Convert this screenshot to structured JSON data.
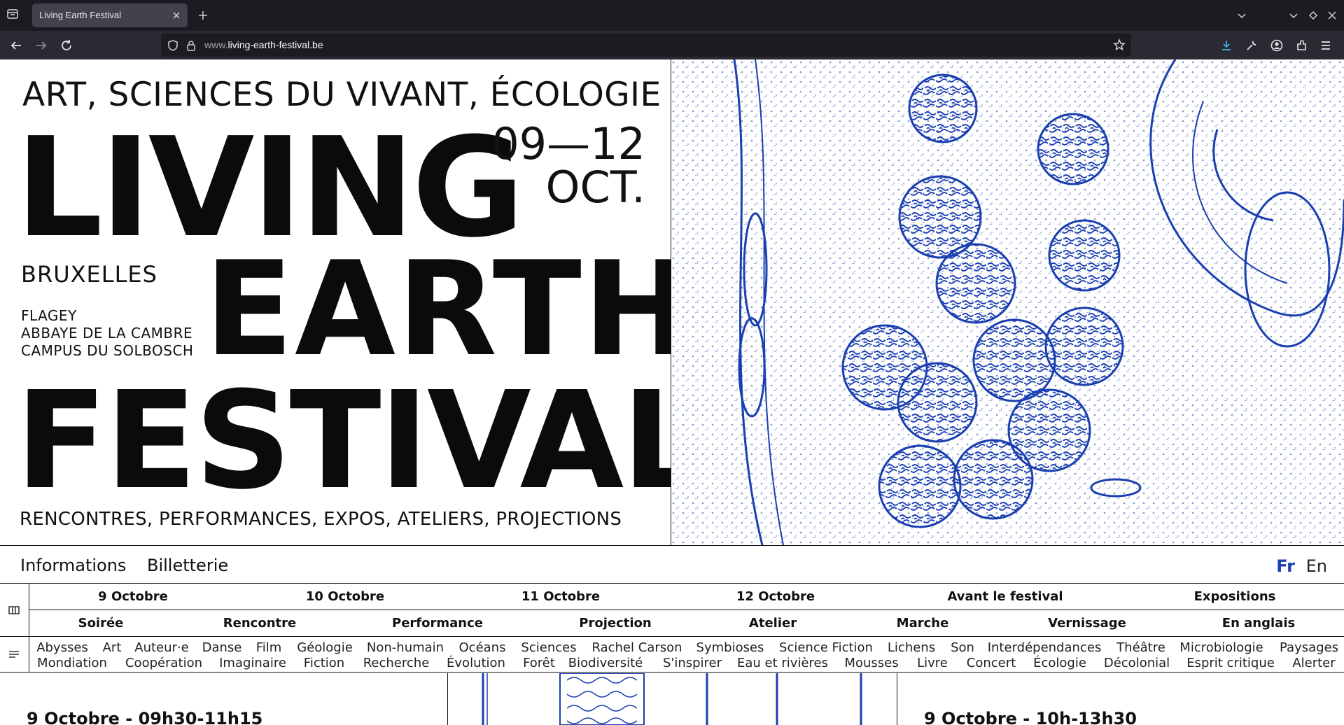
{
  "browser": {
    "tab_title": "Living Earth Festival",
    "url_prefix": "www.",
    "url_domain": "living-earth-festival.be"
  },
  "hero": {
    "tagline": "ART, SCIENCES DU VIVANT, ÉCOLOGIE",
    "word_living": "LIVING",
    "word_earth": "EARTH",
    "word_festival": "FESTIVAL",
    "dates_line1": "09—12",
    "dates_line2": "OCT.",
    "city": "BRUXELLES",
    "venues": [
      "FLAGEY",
      "ABBAYE DE LA CAMBRE",
      "CAMPUS DU SOLBOSCH"
    ],
    "activities": "RENCONTRES, PERFORMANCES, EXPOS, ATELIERS, PROJECTIONS",
    "image_color": "#1a3fb0"
  },
  "nav": {
    "informations": "Informations",
    "billetterie": "Billetterie",
    "lang_fr": "Fr",
    "lang_en": "En"
  },
  "filters": {
    "dates": [
      "9 Octobre",
      "10 Octobre",
      "11 Octobre",
      "12 Octobre",
      "Avant le festival",
      "Expositions"
    ],
    "formats": [
      "Soirée",
      "Rencontre",
      "Performance",
      "Projection",
      "Atelier",
      "Marche",
      "Vernissage",
      "En anglais"
    ],
    "tags_row1": [
      "Abysses",
      "Art",
      "Auteur·e",
      "Danse",
      "Film",
      "Géologie",
      "Non-humain",
      "Océans",
      "Sciences",
      "Rachel Carson",
      "Symbioses",
      "Science Fiction",
      "Lichens",
      "Son",
      "Interdépendances",
      "Théâtre",
      "Microbiologie",
      "Paysages"
    ],
    "tags_row2": [
      "Mondiation",
      "Coopération",
      "Imaginaire",
      "Fiction",
      "Recherche",
      "Évolution",
      "Forêt",
      "Biodiversité",
      "S'inspirer",
      "Eau et rivières",
      "Mousses",
      "Livre",
      "Concert",
      "Écologie",
      "Décolonial",
      "Esprit critique",
      "Alerter"
    ]
  },
  "events": [
    {
      "title": "9 Octobre - 09h30-11h15"
    },
    {
      "title": "9 Octobre - 10h-13h30"
    }
  ]
}
